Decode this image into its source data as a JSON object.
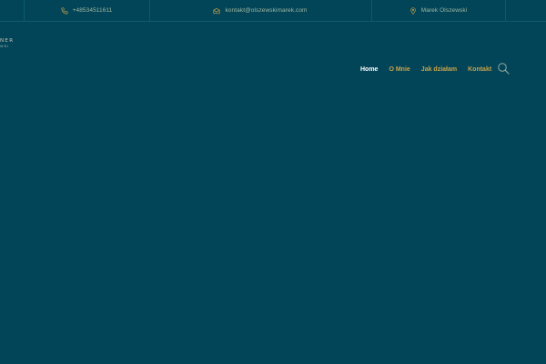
{
  "topbar": {
    "phone": "+48534511611",
    "email": "kontakt@olszewskimarek.com",
    "location": "Marek Olszewski"
  },
  "logo": {
    "line1": "NER",
    "line2": "WNI"
  },
  "nav": {
    "items": [
      {
        "label": "Home",
        "active": true
      },
      {
        "label": "O Mnie",
        "active": false
      },
      {
        "label": "Jak działam",
        "active": false
      },
      {
        "label": "Kontakt",
        "active": false
      }
    ]
  },
  "colors": {
    "background": "#034558",
    "accent": "#c9a24a",
    "topbar_text": "#9fb7a0",
    "nav_active": "#ffffff"
  },
  "icons": {
    "phone": "phone-icon",
    "email": "envelope-icon",
    "location": "map-pin-icon",
    "search": "search-icon"
  }
}
